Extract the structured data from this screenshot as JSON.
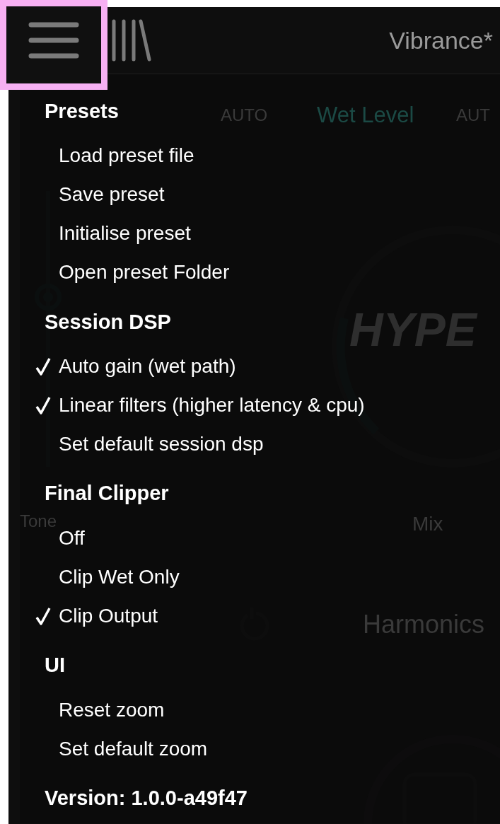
{
  "header": {
    "title": "Vibrance*",
    "menu_button": {
      "highlighted": true
    }
  },
  "background": {
    "labels": [
      {
        "text": "AUTO",
        "kind": "dim"
      },
      {
        "text": "Wet Level",
        "kind": "teal"
      },
      {
        "text": "AUT",
        "kind": "dim"
      },
      {
        "text": "Tone",
        "kind": "dim"
      },
      {
        "text": "Mix",
        "kind": "dim"
      },
      {
        "text": "Harmonics",
        "kind": "dim"
      }
    ],
    "logo": "HYPE"
  },
  "menu": {
    "sections": [
      {
        "title": "Presets",
        "items": [
          {
            "label": "Load preset file",
            "checked": false
          },
          {
            "label": "Save preset",
            "checked": false
          },
          {
            "label": "Initialise preset",
            "checked": false
          },
          {
            "label": "Open preset Folder",
            "checked": false
          }
        ]
      },
      {
        "title": "Session DSP",
        "items": [
          {
            "label": "Auto gain (wet path)",
            "checked": true
          },
          {
            "label": "Linear filters (higher latency & cpu)",
            "checked": true
          },
          {
            "label": "Set default session dsp",
            "checked": false
          }
        ]
      },
      {
        "title": "Final Clipper",
        "items": [
          {
            "label": "Off",
            "checked": false
          },
          {
            "label": "Clip Wet Only",
            "checked": false
          },
          {
            "label": "Clip Output",
            "checked": true
          }
        ]
      },
      {
        "title": "UI",
        "items": [
          {
            "label": "Reset zoom",
            "checked": false
          },
          {
            "label": "Set default zoom",
            "checked": false
          }
        ]
      }
    ],
    "version": "Version: 1.0.0-a49f47"
  }
}
